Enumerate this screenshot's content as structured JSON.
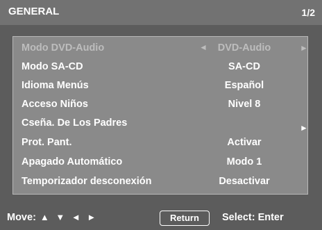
{
  "header": {
    "title": "GENERAL",
    "page": "1/2"
  },
  "menu": {
    "items": [
      {
        "label": "Modo DVD-Audio",
        "value": "DVD-Audio",
        "left_arrow": "◄",
        "right_arrow": "►"
      },
      {
        "label": "Modo SA-CD",
        "value": "SA-CD"
      },
      {
        "label": "Idioma Menús",
        "value": "Español"
      },
      {
        "label": "Acceso Niños",
        "value": "Nivel 8"
      },
      {
        "label": "Cseña. De Los Padres",
        "value": "",
        "right_arrow": "►"
      },
      {
        "label": "Prot. Pant.",
        "value": "Activar"
      },
      {
        "label": "Apagado Automático",
        "value": "Modo 1"
      },
      {
        "label": "Temporizador desconexión",
        "value": "Desactivar"
      }
    ]
  },
  "footer": {
    "move_label": "Move:",
    "move_arrows": "▲ ▼ ◄ ►",
    "return_label": "Return",
    "select_label": "Select: Enter"
  }
}
